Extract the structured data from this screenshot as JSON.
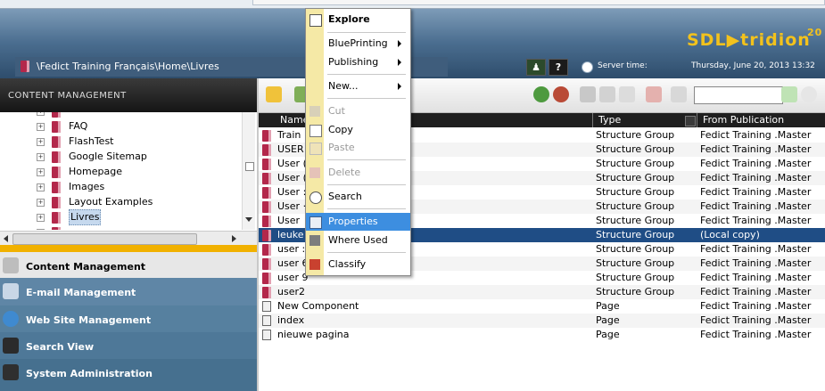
{
  "header": {
    "breadcrumb": "\\Fedict Training Français\\Home\\Livres",
    "logo_text": "SDL▶tridion",
    "logo_sup": "20",
    "help_label": "?",
    "server_time_label": "Server time:",
    "server_time_value": "Thursday, June 20, 2013 13:32"
  },
  "left_panel": {
    "section_title": "CONTENT MANAGEMENT",
    "tree": [
      {
        "label": "FAQ"
      },
      {
        "label": "FlashTest"
      },
      {
        "label": "Google Sitemap"
      },
      {
        "label": "Homepage"
      },
      {
        "label": "Images"
      },
      {
        "label": "Layout Examples"
      },
      {
        "label": "Livres",
        "selected": true
      }
    ],
    "nav": {
      "content": "Content Management",
      "email": "E-mail Management",
      "web": "Web Site Management",
      "search": "Search View",
      "sysadmin": "System Administration"
    }
  },
  "grid": {
    "columns": {
      "name": "Name",
      "type": "Type",
      "from": "From Publication"
    },
    "rows": [
      {
        "name": "Train",
        "type": "Structure Group",
        "from": "Fedict Training .Master",
        "icon": "book"
      },
      {
        "name": "USER",
        "type": "Structure Group",
        "from": "Fedict Training .Master",
        "icon": "book"
      },
      {
        "name": "User (",
        "type": "Structure Group",
        "from": "Fedict Training .Master",
        "icon": "book"
      },
      {
        "name": "User (",
        "type": "Structure Group",
        "from": "Fedict Training .Master",
        "icon": "book"
      },
      {
        "name": "User :",
        "type": "Structure Group",
        "from": "Fedict Training .Master",
        "icon": "book"
      },
      {
        "name": "User ·",
        "type": "Structure Group",
        "from": "Fedict Training .Master",
        "icon": "book"
      },
      {
        "name": "User",
        "type": "Structure Group",
        "from": "Fedict Training .Master",
        "icon": "book"
      },
      {
        "name": "leuke",
        "type": "Structure Group",
        "from": "(Local copy)",
        "icon": "book",
        "selected": true
      },
      {
        "name": "user :",
        "type": "Structure Group",
        "from": "Fedict Training .Master",
        "icon": "book"
      },
      {
        "name": "user 6",
        "type": "Structure Group",
        "from": "Fedict Training .Master",
        "icon": "book"
      },
      {
        "name": "user 9",
        "type": "Structure Group",
        "from": "Fedict Training .Master",
        "icon": "book"
      },
      {
        "name": "user2",
        "type": "Structure Group",
        "from": "Fedict Training .Master",
        "icon": "book"
      },
      {
        "name": "New Component",
        "type": "Page",
        "from": "Fedict Training .Master",
        "icon": "page"
      },
      {
        "name": "index",
        "type": "Page",
        "from": "Fedict Training .Master",
        "icon": "page"
      },
      {
        "name": "nieuwe pagina",
        "type": "Page",
        "from": "Fedict Training .Master",
        "icon": "page"
      }
    ]
  },
  "context_menu": {
    "explore": "Explore",
    "blueprinting": "BluePrinting",
    "publishing": "Publishing",
    "new": "New...",
    "cut": "Cut",
    "copy": "Copy",
    "paste": "Paste",
    "delete": "Delete",
    "search": "Search",
    "properties": "Properties",
    "where_used": "Where Used",
    "classify": "Classify"
  },
  "colors": {
    "accent": "#f1b100",
    "selection": "#1f4d85",
    "menu_highlight": "#3d8ee0",
    "book_icon": "#b3284b"
  }
}
